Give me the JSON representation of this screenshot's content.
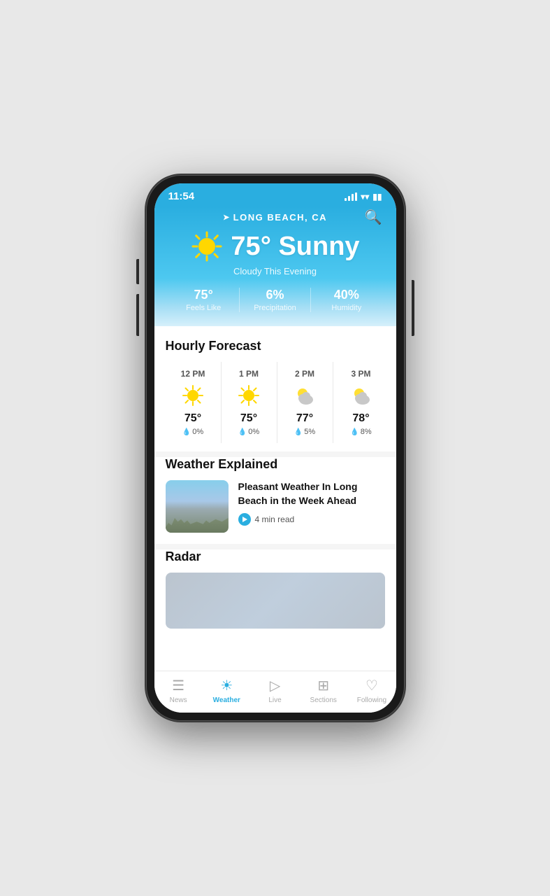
{
  "statusBar": {
    "time": "11:54",
    "signalBars": [
      4,
      7,
      10,
      12
    ],
    "wifi": "wifi",
    "battery": "battery"
  },
  "header": {
    "locationArrow": "➤",
    "location": "LONG BEACH, CA",
    "searchIcon": "search"
  },
  "weather": {
    "temperature": "75°",
    "condition": "Sunny",
    "subtitle": "Cloudy This Evening",
    "stats": [
      {
        "value": "75°",
        "label": "Feels Like"
      },
      {
        "value": "6%",
        "label": "Precipitation"
      },
      {
        "value": "40%",
        "label": "Humidity"
      }
    ]
  },
  "hourlyForecast": {
    "title": "Hourly Forecast",
    "hours": [
      {
        "time": "12 PM",
        "icon": "sun",
        "temp": "75°",
        "precip": "0%"
      },
      {
        "time": "1 PM",
        "icon": "sun",
        "temp": "75°",
        "precip": "0%"
      },
      {
        "time": "2 PM",
        "icon": "partly-cloudy",
        "temp": "77°",
        "precip": "5%"
      },
      {
        "time": "3 PM",
        "icon": "partly-cloudy",
        "temp": "78°",
        "precip": "8%"
      }
    ]
  },
  "weatherExplained": {
    "title": "Weather Explained",
    "article": {
      "title": "Pleasant Weather In Long Beach in the Week Ahead",
      "readTime": "4 min read"
    }
  },
  "radar": {
    "title": "Radar"
  },
  "bottomNav": [
    {
      "id": "news",
      "icon": "≡",
      "label": "News",
      "active": false
    },
    {
      "id": "weather",
      "icon": "☀",
      "label": "Weather",
      "active": true
    },
    {
      "id": "live",
      "icon": "▷",
      "label": "Live",
      "active": false
    },
    {
      "id": "sections",
      "icon": "⊞",
      "label": "Sections",
      "active": false
    },
    {
      "id": "following",
      "icon": "♡",
      "label": "Following",
      "active": false
    }
  ]
}
